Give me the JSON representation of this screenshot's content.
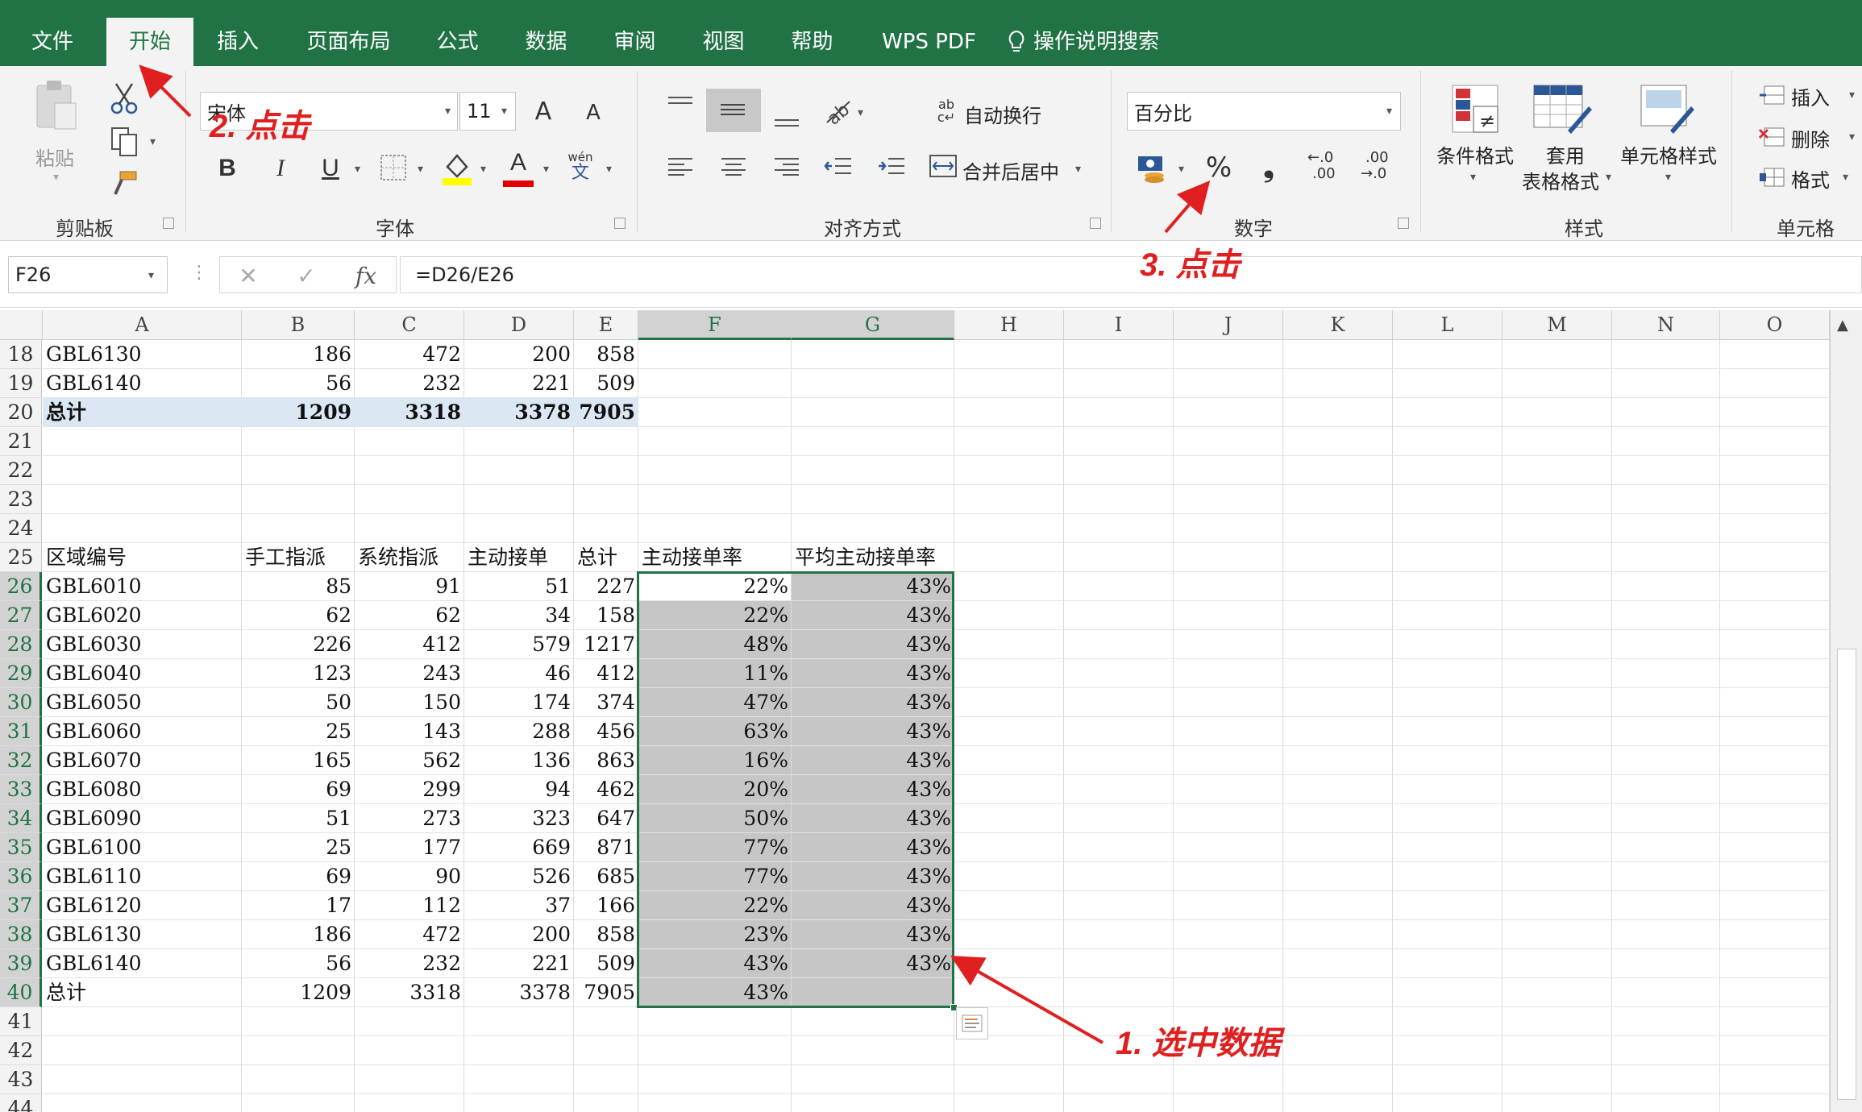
{
  "tabs": [
    "文件",
    "开始",
    "插入",
    "页面布局",
    "公式",
    "数据",
    "审阅",
    "视图",
    "帮助",
    "WPS PDF"
  ],
  "tell_me": "操作说明搜索",
  "clipboard": {
    "paste": "粘贴",
    "group": "剪贴板"
  },
  "font": {
    "name": "宋体",
    "size": "11",
    "group": "字体",
    "bold": "B",
    "italic": "I",
    "underline": "U",
    "grow": "A",
    "shrink": "A",
    "font_color": "A",
    "phonetic_top": "wén",
    "phonetic_bottom": "文"
  },
  "alignment": {
    "wrap": "自动换行",
    "merge": "合并后居中",
    "group": "对齐方式"
  },
  "number": {
    "format": "百分比",
    "group": "数字",
    "percent": "%",
    "comma": "❟",
    "inc_dec_top": "←.0",
    "inc_dec_bottom": ".00",
    "dec_dec_top": ".00",
    "dec_dec_bottom": "→.0"
  },
  "styles": {
    "conditional": "条件格式",
    "table_line1": "套用",
    "table_line2": "表格格式",
    "cell_styles": "单元格样式",
    "group": "样式"
  },
  "cells": {
    "insert": "插入",
    "delete": "删除",
    "format": "格式",
    "group": "单元格"
  },
  "formula_bar": {
    "name_box": "F26",
    "fx": "fx",
    "formula": "=D26/E26"
  },
  "columns": [
    "A",
    "B",
    "C",
    "D",
    "E",
    "F",
    "G",
    "H",
    "I",
    "J",
    "K",
    "L",
    "M",
    "N",
    "O"
  ],
  "rows": [
    {
      "n": "18",
      "a": "GBL6130",
      "b": "186",
      "c": "472",
      "d": "200",
      "e": "858",
      "f": "",
      "g": ""
    },
    {
      "n": "19",
      "a": "GBL6140",
      "b": "56",
      "c": "232",
      "d": "221",
      "e": "509",
      "f": "",
      "g": ""
    },
    {
      "n": "20",
      "a": "总计",
      "b": "1209",
      "c": "3318",
      "d": "3378",
      "e": "7905",
      "f": "",
      "g": "",
      "total": true
    },
    {
      "n": "21",
      "a": "",
      "b": "",
      "c": "",
      "d": "",
      "e": "",
      "f": "",
      "g": ""
    },
    {
      "n": "22",
      "a": "",
      "b": "",
      "c": "",
      "d": "",
      "e": "",
      "f": "",
      "g": ""
    },
    {
      "n": "23",
      "a": "",
      "b": "",
      "c": "",
      "d": "",
      "e": "",
      "f": "",
      "g": ""
    },
    {
      "n": "24",
      "a": "",
      "b": "",
      "c": "",
      "d": "",
      "e": "",
      "f": "",
      "g": ""
    },
    {
      "n": "25",
      "a": "区域编号",
      "b": "手工指派",
      "c": "系统指派",
      "d": "主动接单",
      "e": "总计",
      "f": "主动接单率",
      "g": "平均主动接单率",
      "header": true
    },
    {
      "n": "26",
      "a": "GBL6010",
      "b": "85",
      "c": "91",
      "d": "51",
      "e": "227",
      "f": "22%",
      "g": "43%"
    },
    {
      "n": "27",
      "a": "GBL6020",
      "b": "62",
      "c": "62",
      "d": "34",
      "e": "158",
      "f": "22%",
      "g": "43%"
    },
    {
      "n": "28",
      "a": "GBL6030",
      "b": "226",
      "c": "412",
      "d": "579",
      "e": "1217",
      "f": "48%",
      "g": "43%"
    },
    {
      "n": "29",
      "a": "GBL6040",
      "b": "123",
      "c": "243",
      "d": "46",
      "e": "412",
      "f": "11%",
      "g": "43%"
    },
    {
      "n": "30",
      "a": "GBL6050",
      "b": "50",
      "c": "150",
      "d": "174",
      "e": "374",
      "f": "47%",
      "g": "43%"
    },
    {
      "n": "31",
      "a": "GBL6060",
      "b": "25",
      "c": "143",
      "d": "288",
      "e": "456",
      "f": "63%",
      "g": "43%"
    },
    {
      "n": "32",
      "a": "GBL6070",
      "b": "165",
      "c": "562",
      "d": "136",
      "e": "863",
      "f": "16%",
      "g": "43%"
    },
    {
      "n": "33",
      "a": "GBL6080",
      "b": "69",
      "c": "299",
      "d": "94",
      "e": "462",
      "f": "20%",
      "g": "43%"
    },
    {
      "n": "34",
      "a": "GBL6090",
      "b": "51",
      "c": "273",
      "d": "323",
      "e": "647",
      "f": "50%",
      "g": "43%"
    },
    {
      "n": "35",
      "a": "GBL6100",
      "b": "25",
      "c": "177",
      "d": "669",
      "e": "871",
      "f": "77%",
      "g": "43%"
    },
    {
      "n": "36",
      "a": "GBL6110",
      "b": "69",
      "c": "90",
      "d": "526",
      "e": "685",
      "f": "77%",
      "g": "43%"
    },
    {
      "n": "37",
      "a": "GBL6120",
      "b": "17",
      "c": "112",
      "d": "37",
      "e": "166",
      "f": "22%",
      "g": "43%"
    },
    {
      "n": "38",
      "a": "GBL6130",
      "b": "186",
      "c": "472",
      "d": "200",
      "e": "858",
      "f": "23%",
      "g": "43%"
    },
    {
      "n": "39",
      "a": "GBL6140",
      "b": "56",
      "c": "232",
      "d": "221",
      "e": "509",
      "f": "43%",
      "g": "43%"
    },
    {
      "n": "40",
      "a": "总计",
      "b": "1209",
      "c": "3318",
      "d": "3378",
      "e": "7905",
      "f": "43%",
      "g": ""
    },
    {
      "n": "41",
      "a": "",
      "b": "",
      "c": "",
      "d": "",
      "e": "",
      "f": "",
      "g": ""
    },
    {
      "n": "42",
      "a": "",
      "b": "",
      "c": "",
      "d": "",
      "e": "",
      "f": "",
      "g": ""
    },
    {
      "n": "43",
      "a": "",
      "b": "",
      "c": "",
      "d": "",
      "e": "",
      "f": "",
      "g": ""
    },
    {
      "n": "44",
      "a": "",
      "b": "",
      "c": "",
      "d": "",
      "e": "",
      "f": "",
      "g": ""
    }
  ],
  "annotations": {
    "step1": "1. 选中数据",
    "step2": "2. 点击",
    "step3": "3. 点击"
  },
  "colors": {
    "excel_green": "#217346",
    "selection_fill": "#c6c6c6",
    "total_row_fill": "#dbe8f4",
    "annotation_red": "#e02020"
  }
}
